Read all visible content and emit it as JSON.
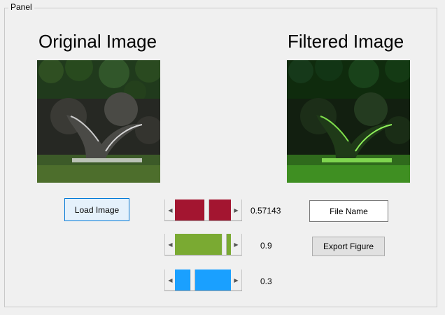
{
  "panel": {
    "title": "Panel"
  },
  "original": {
    "title": "Original Image",
    "icon": "whale-tail-photo"
  },
  "filtered": {
    "title": "Filtered Image",
    "icon": "whale-tail-green-filtered-photo"
  },
  "load_button": {
    "label": "Load Image"
  },
  "file_name": {
    "value": "File Name"
  },
  "export_button": {
    "label": "Export Figure"
  },
  "sliders": [
    {
      "value": 0.57143,
      "label": "0.57143",
      "color": "#a31530"
    },
    {
      "value": 0.9,
      "label": "0.9",
      "color": "#7aaa32"
    },
    {
      "value": 0.3,
      "label": "0.3",
      "color": "#1aa0ff"
    }
  ]
}
